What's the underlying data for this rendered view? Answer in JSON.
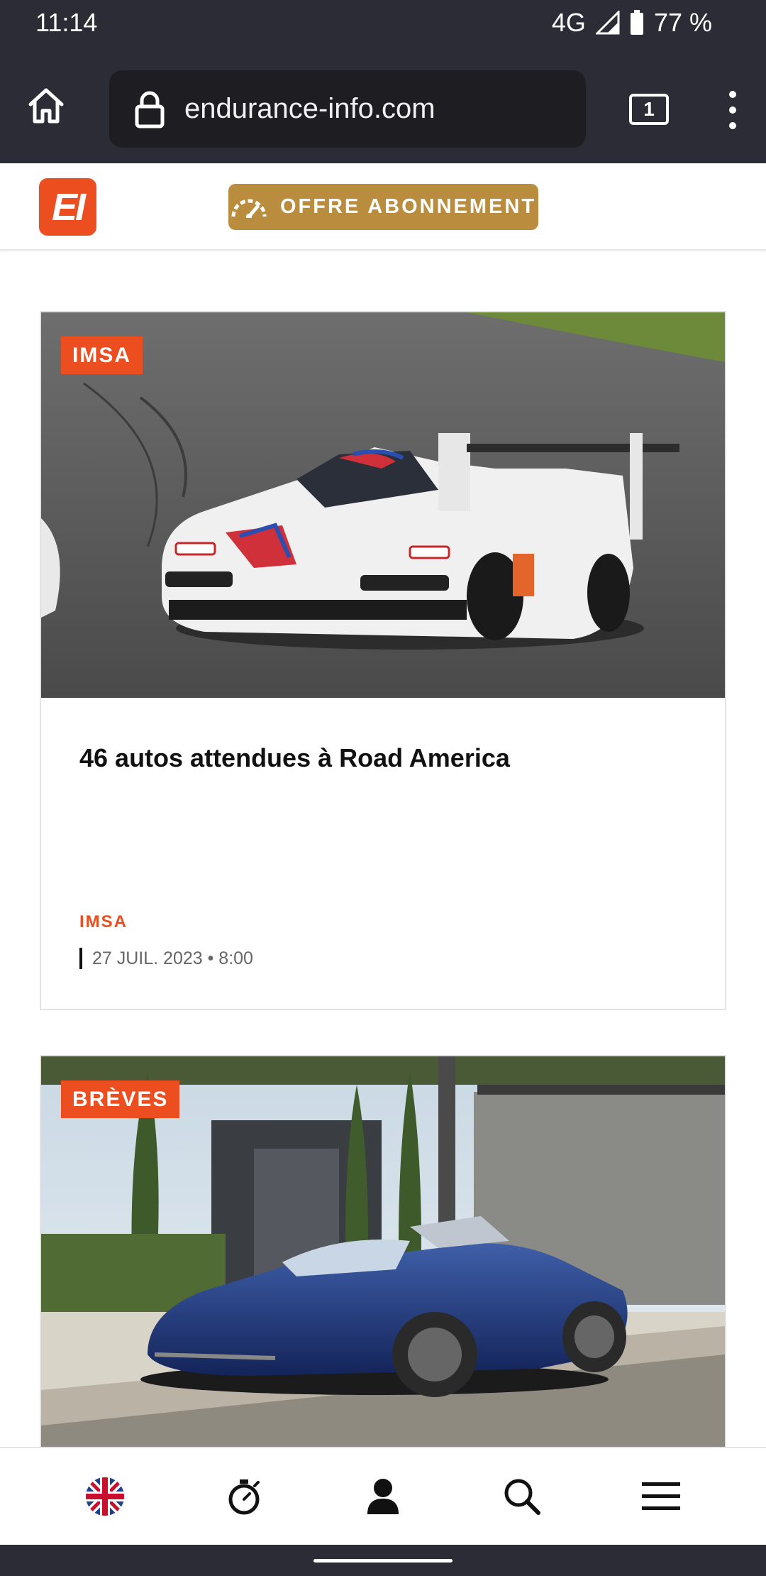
{
  "status_bar": {
    "time": "11:14",
    "network": "4G",
    "battery": "77 %"
  },
  "browser": {
    "url": "endurance-info.com",
    "tab_count": "1"
  },
  "site_header": {
    "logo_text": "EI",
    "subscribe_label": "OFFRE ABONNEMENT",
    "accent_color": "#ec4e20",
    "subscribe_color": "#b98c3e"
  },
  "articles": [
    {
      "tag": "IMSA",
      "title": "46 autos attendues à Road America",
      "category": "IMSA",
      "date": "27 JUIL. 2023 • 8:00"
    },
    {
      "tag": "BRÈVES"
    }
  ],
  "bottom_nav": {
    "items": [
      "uk-flag-icon",
      "stopwatch-icon",
      "user-icon",
      "search-icon",
      "menu-icon"
    ]
  }
}
